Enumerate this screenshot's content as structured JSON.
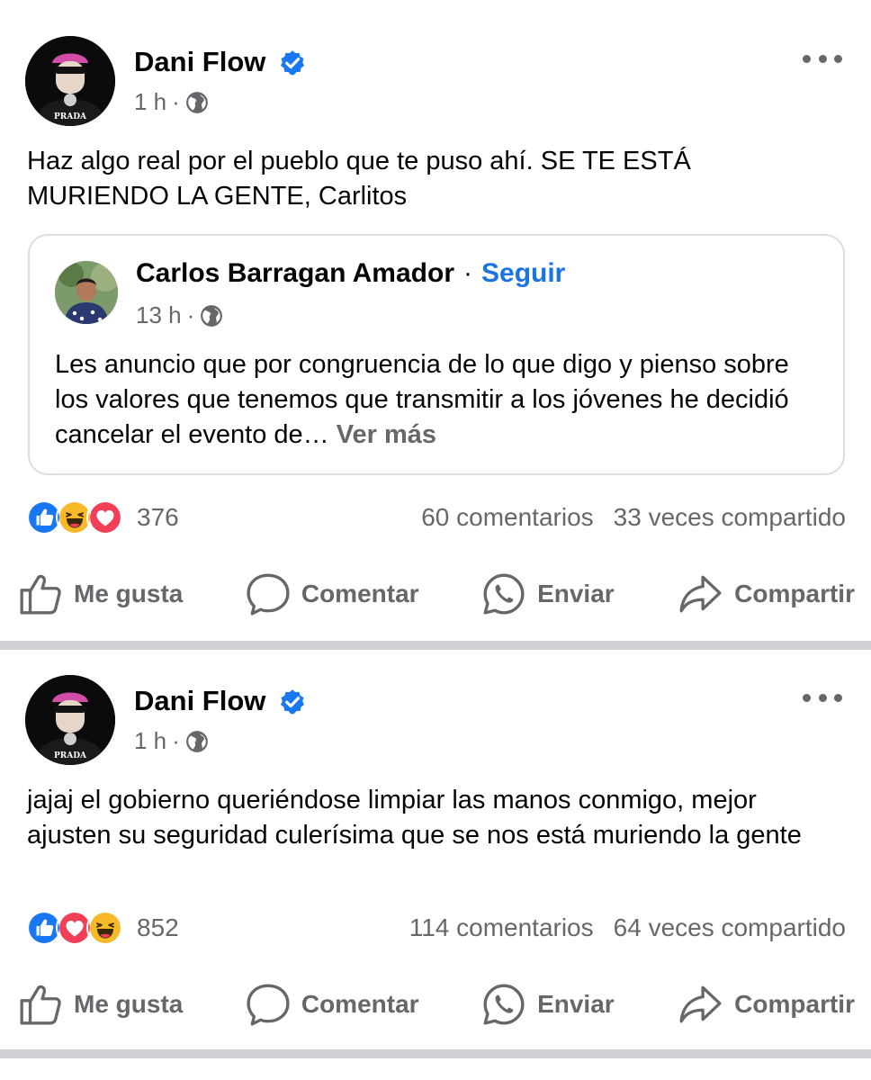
{
  "posts": [
    {
      "author": "Dani Flow",
      "time": "1 h",
      "dot": "·",
      "text": "Haz algo real por el pueblo que te puso ahí. SE TE ESTÁ MURIENDO LA GENTE, Carlitos",
      "shared": {
        "author": "Carlos Barragan Amador",
        "separator": "·",
        "follow": "Seguir",
        "time": "13 h",
        "text": "Les anuncio que por congruencia de lo que digo y pienso sobre los valores que tenemos que transmitir a los jóvenes he decidió cancelar el evento de…",
        "more": "Ver más"
      },
      "reaction_count": "376",
      "comments": "60 comentarios",
      "shares": "33 veces compartido"
    },
    {
      "author": "Dani Flow",
      "time": "1 h",
      "dot": "·",
      "text": "jajaj el gobierno queriéndose limpiar las manos conmigo, mejor ajusten su seguridad culerísima que se nos está muriendo la gente",
      "reaction_count": "852",
      "comments": "114 comentarios",
      "shares": "64 veces compartido"
    }
  ],
  "actions": {
    "like": "Me gusta",
    "comment": "Comentar",
    "send": "Enviar",
    "share": "Compartir"
  },
  "avatar_text": "PRADA",
  "colors": {
    "link": "#1b74e4",
    "verified": "#1877f2",
    "like": "#1877f2",
    "love": "#f33e58",
    "haha": "#f7b928",
    "muted": "#65676b"
  },
  "icons": [
    "verified-badge-icon",
    "globe-icon",
    "more-icon",
    "like-reaction-icon",
    "haha-reaction-icon",
    "love-reaction-icon",
    "thumbs-up-icon",
    "comment-icon",
    "whatsapp-icon",
    "share-icon"
  ]
}
